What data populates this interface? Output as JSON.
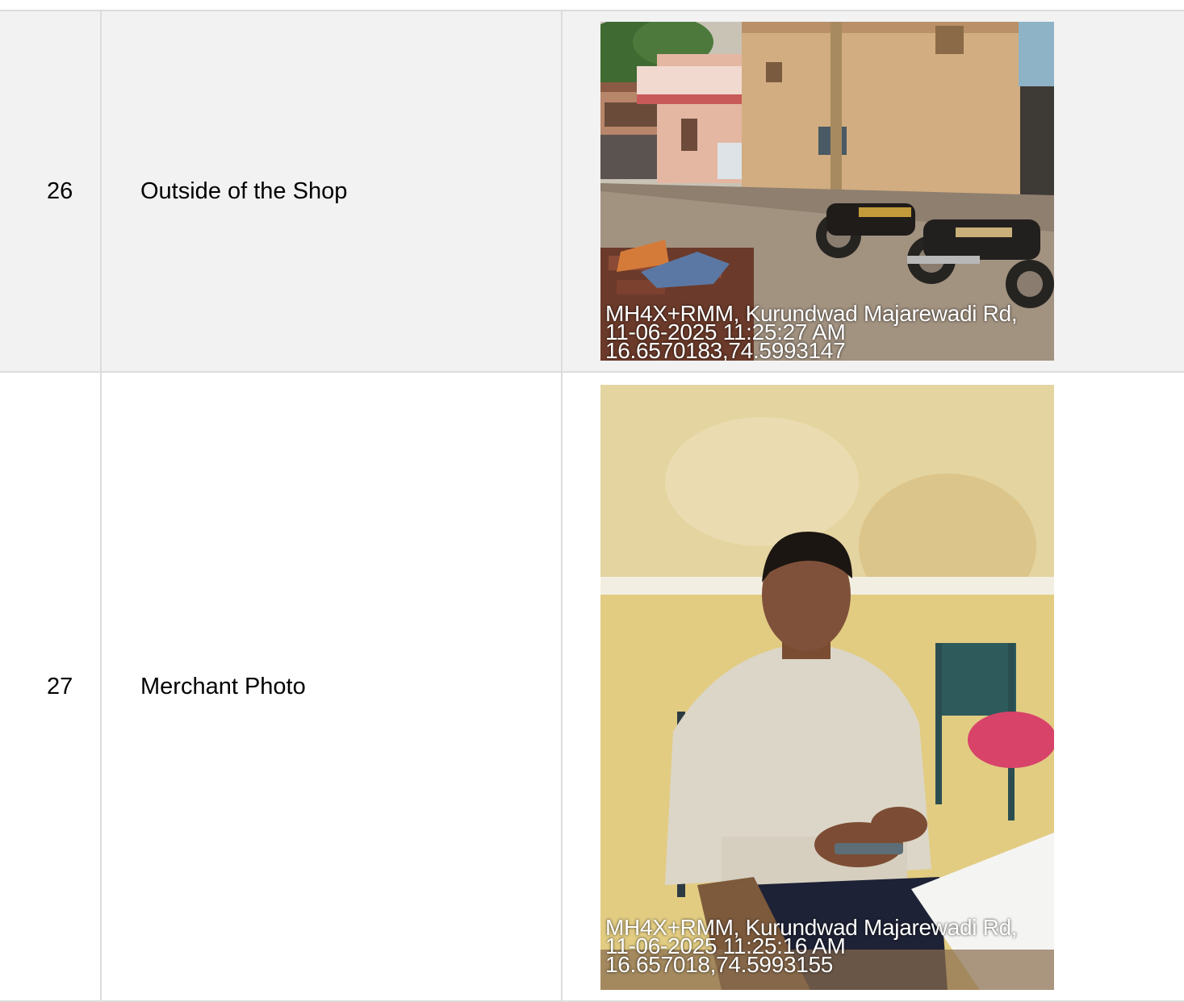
{
  "rows": [
    {
      "number": "26",
      "label": "Outside of the Shop",
      "photo": {
        "icon": "street-shop-photo",
        "stamp": {
          "address": "MH4X+RMM, Kurundwad Majarewadi Rd,",
          "datetime": "11-06-2025 11:25:27 AM",
          "coords": "16.6570183,74.5993147"
        }
      }
    },
    {
      "number": "27",
      "label": "Merchant Photo",
      "photo": {
        "icon": "merchant-portrait-photo",
        "stamp": {
          "address": "MH4X+RMM, Kurundwad Majarewadi Rd,",
          "datetime": "11-06-2025 11:25:16 AM",
          "coords": "16.657018,74.5993155"
        }
      }
    }
  ]
}
